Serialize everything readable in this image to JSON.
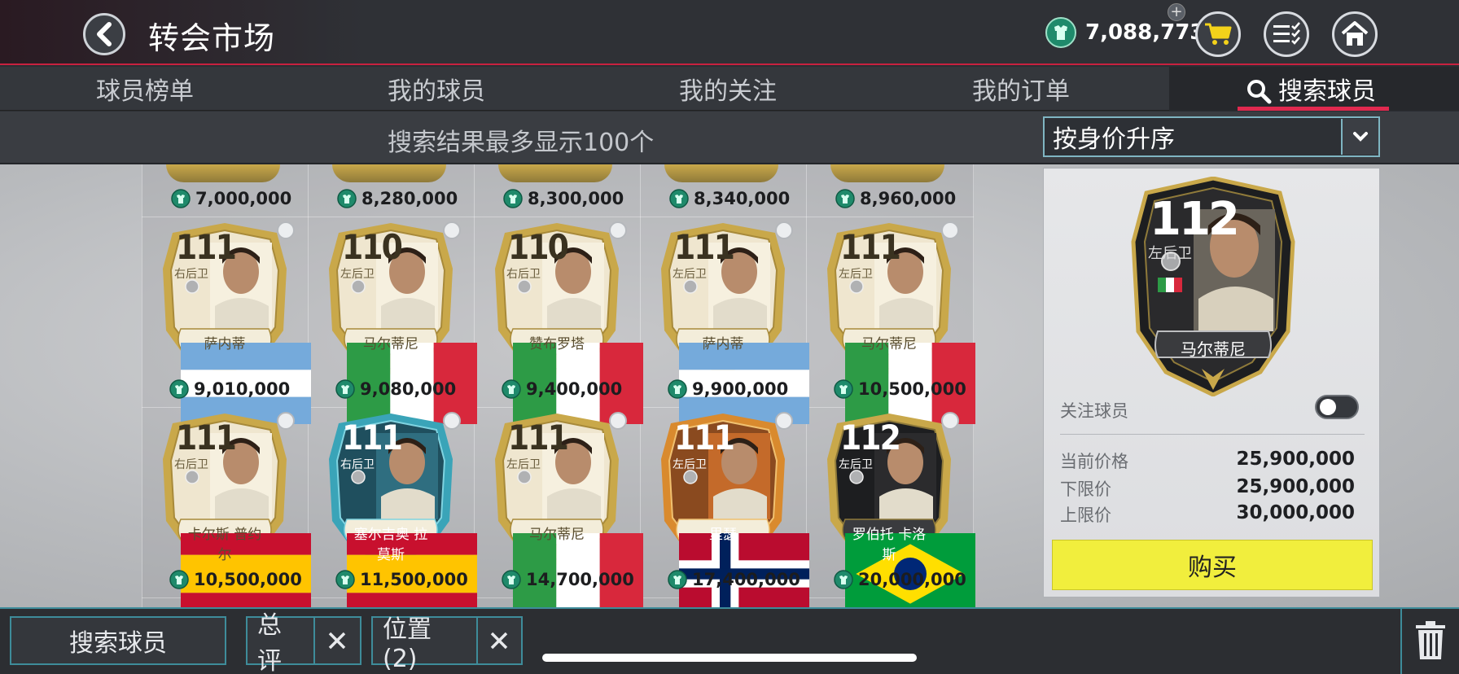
{
  "header": {
    "title": "转会市场",
    "coins": "7,088,773"
  },
  "tabs": [
    {
      "label": "球员榜单"
    },
    {
      "label": "我的球员"
    },
    {
      "label": "我的关注"
    },
    {
      "label": "我的订单"
    },
    {
      "label": "搜索球员",
      "active": true
    }
  ],
  "filter": {
    "note": "搜索结果最多显示100个",
    "sort_label": "按身价升序"
  },
  "partial_row_prices": [
    "7,000,000",
    "8,280,000",
    "8,300,000",
    "8,340,000",
    "8,960,000"
  ],
  "rows": [
    [
      {
        "ovr": "111",
        "pos": "右后卫",
        "name": "萨内蒂",
        "price": "9,010,000",
        "style": "gold",
        "flag": "argentina"
      },
      {
        "ovr": "110",
        "pos": "左后卫",
        "name": "马尔蒂尼",
        "price": "9,080,000",
        "style": "gold",
        "flag": "italy"
      },
      {
        "ovr": "110",
        "pos": "右后卫",
        "name": "赞布罗塔",
        "price": "9,400,000",
        "style": "gold",
        "flag": "italy"
      },
      {
        "ovr": "111",
        "pos": "左后卫",
        "name": "萨内蒂",
        "price": "9,900,000",
        "style": "gold",
        "flag": "argentina"
      },
      {
        "ovr": "111",
        "pos": "左后卫",
        "name": "马尔蒂尼",
        "price": "10,500,000",
        "style": "gold",
        "flag": "italy"
      }
    ],
    [
      {
        "ovr": "111",
        "pos": "右后卫",
        "name": "卡尔斯 普约尔",
        "price": "10,500,000",
        "style": "gold",
        "flag": "spain"
      },
      {
        "ovr": "111",
        "pos": "右后卫",
        "name": "塞尔吉奥 拉莫斯",
        "price": "11,500,000",
        "style": "blue",
        "flag": "spain"
      },
      {
        "ovr": "111",
        "pos": "左后卫",
        "name": "马尔蒂尼",
        "price": "14,700,000",
        "style": "gold",
        "flag": "italy"
      },
      {
        "ovr": "111",
        "pos": "左后卫",
        "name": "里瑟",
        "price": "17,400,000",
        "style": "orange",
        "flag": "norway"
      },
      {
        "ovr": "112",
        "pos": "左后卫",
        "name": "罗伯托 卡洛斯",
        "price": "20,000,000",
        "style": "dark",
        "flag": "brazil"
      }
    ]
  ],
  "detail": {
    "ovr": "112",
    "pos": "左后卫",
    "name": "马尔蒂尼",
    "follow_label": "关注球员",
    "current_price_label": "当前价格",
    "current_price": "25,900,000",
    "lower_limit_label": "下限价",
    "lower_limit": "25,900,000",
    "upper_limit_label": "上限价",
    "upper_limit": "30,000,000",
    "buy_label": "购买"
  },
  "bottom": {
    "search_label": "搜索球员",
    "chip_rating": "总评",
    "chip_position": "位置 (2)"
  },
  "colors": {
    "accent_red": "#e0294f",
    "teal_border": "#3e8c9a",
    "buy_yellow": "#f1ee3d",
    "coin_green": "#1f8a6b"
  }
}
